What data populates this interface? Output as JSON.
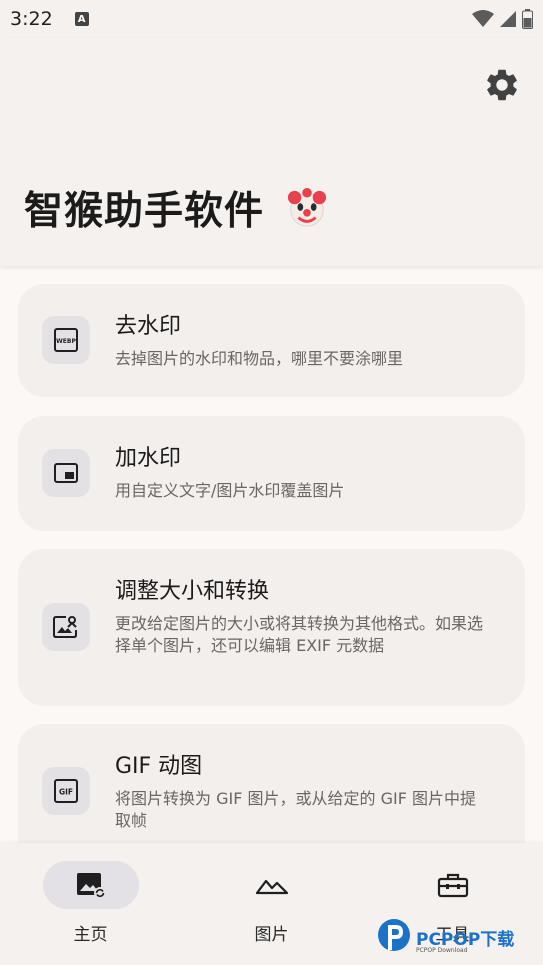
{
  "status_bar": {
    "time": "3:22",
    "notif_letter": "A"
  },
  "header": {
    "title": "智猴助手软件"
  },
  "cards": [
    {
      "title": "去水印",
      "description": "去掉图片的水印和物品，哪里不要涂哪里",
      "icon": "webp-icon",
      "icon_text": "WEBP"
    },
    {
      "title": "加水印",
      "description": "用自定义文字/图片水印覆盖图片",
      "icon": "picture-in-picture-icon"
    },
    {
      "title": "调整大小和转换",
      "description": "更改给定图片的大小或将其转换为其他格式。如果选择单个图片，还可以编辑 EXIF 元数据",
      "icon": "image-edit-icon"
    },
    {
      "title": "GIF 动图",
      "description": "将图片转换为 GIF 图片，或从给定的 GIF 图片中提取帧",
      "icon": "gif-icon",
      "icon_text": "GIF"
    }
  ],
  "bottom_nav": [
    {
      "label": "主页",
      "icon": "home-image-icon",
      "active": true
    },
    {
      "label": "图片",
      "icon": "mountains-icon",
      "active": false
    },
    {
      "label": "工具",
      "icon": "toolbox-icon",
      "active": false
    }
  ],
  "watermark": {
    "text": "PCPOP下载",
    "sub": "PCPOP Download"
  },
  "colors": {
    "background": "#fbf8f6",
    "card": "#f2efed",
    "icon_bg": "#e3e1e4",
    "watermark_blue": "#1b72c7"
  }
}
